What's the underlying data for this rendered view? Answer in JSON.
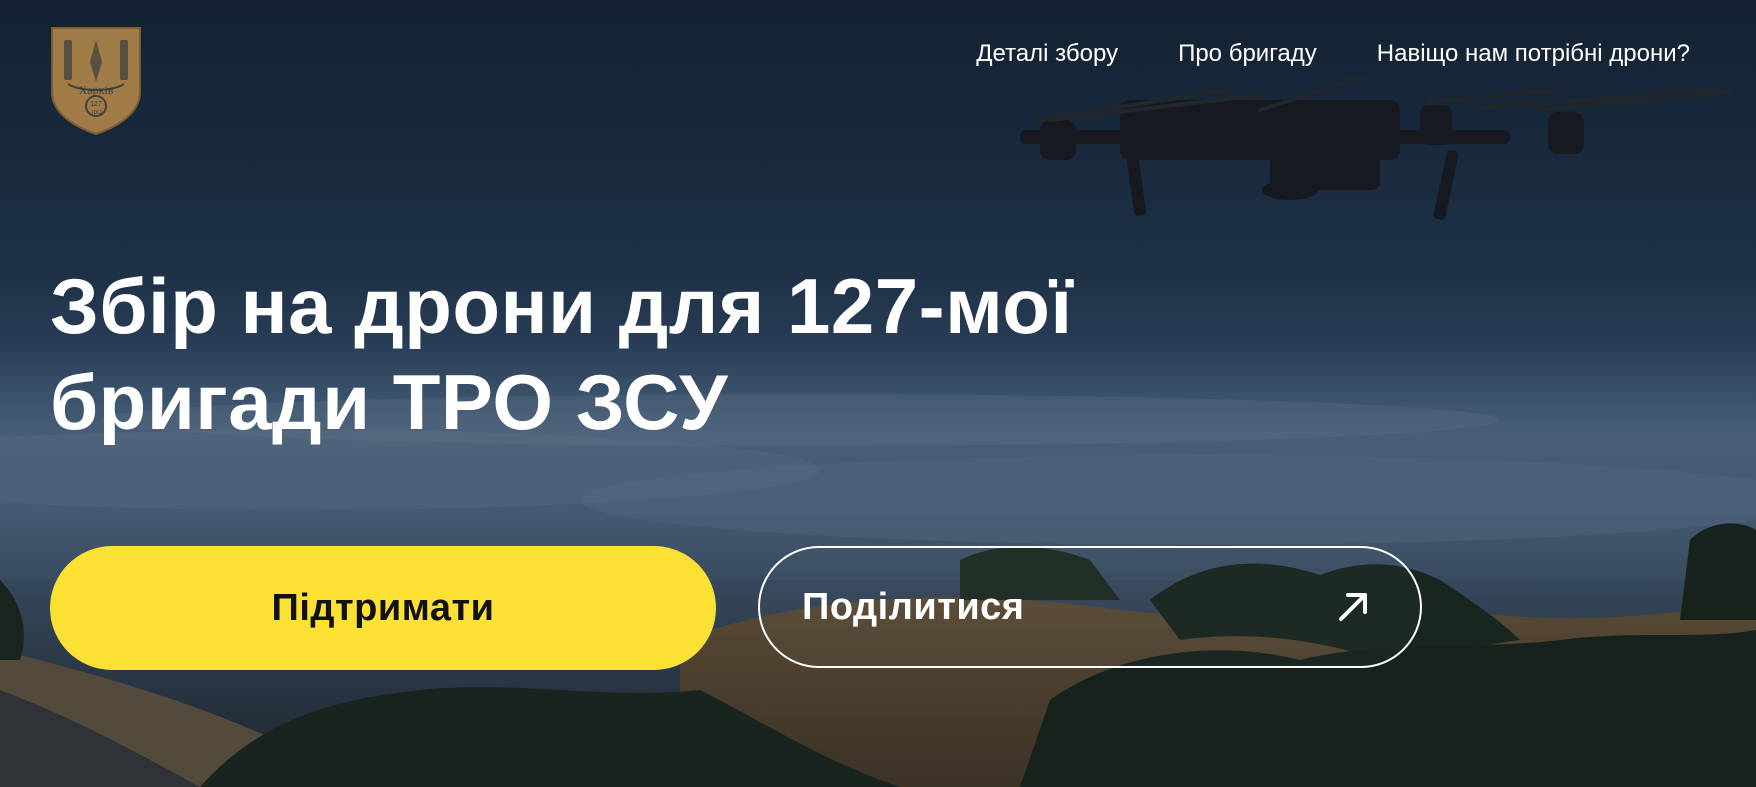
{
  "brand": {
    "logo_icon": "kharkiv-brigade-shield-icon",
    "logo_texts": [
      "Харків",
      "127",
      "ТрО"
    ],
    "logo_color": "#a07c46"
  },
  "nav": {
    "items": [
      {
        "label": "Деталі збору"
      },
      {
        "label": "Про бригаду"
      },
      {
        "label": "Навіщо нам потрібні дрони?"
      }
    ]
  },
  "hero": {
    "title_line1": "Збір на дрони для 127-мої",
    "title_line2": "бригади ТРО ЗСУ",
    "background_image": "drone flying over hills and sea of clouds"
  },
  "actions": {
    "support_label": "Підтримати",
    "support_color": "#fce135",
    "share_label": "Поділитися",
    "share_icon": "arrow-up-right-icon"
  }
}
